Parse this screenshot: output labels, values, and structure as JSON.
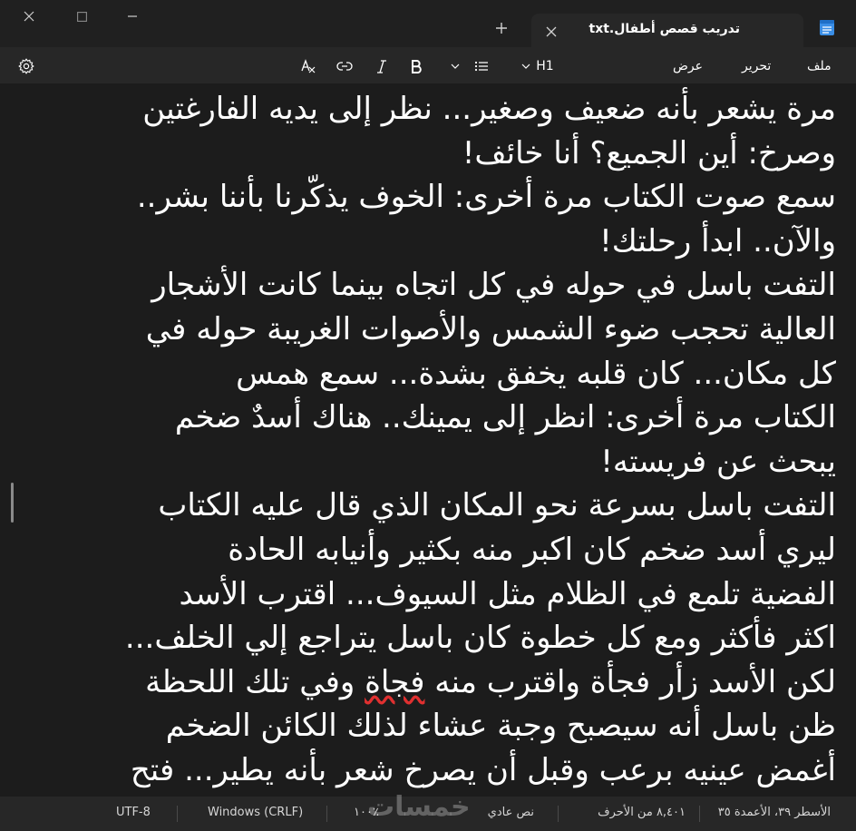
{
  "window": {
    "tab_title": "تدريب قصص أطفال.txt"
  },
  "menu": {
    "file": "ملف",
    "edit": "تحرير",
    "view": "عرض"
  },
  "toolbar": {
    "heading": "H1"
  },
  "editor": {
    "lines": [
      "مرة يشعر بأنه ضعيف وصغير... نظر إلى يديه الفارغتين",
      "وصرخ: أين الجميع؟ أنا خائف!",
      "سمع صوت الكتاب مرة أخرى: الخوف يذكّرنا بأننا بشر..",
      "والآن.. ابدأ رحلتك!",
      "التفت باسل في حوله في كل اتجاه بينما كانت الأشجار",
      " العالية تحجب ضوء الشمس والأصوات الغريبة حوله في",
      "كل مكان... كان قلبه يخفق بشدة... سمع همس",
      "الكتاب مرة أخرى: انظر إلى يمينك.. هناك أسدٌ ضخم",
      "يبحث عن فريسته!",
      "التفت باسل بسرعة نحو المكان الذي قال عليه الكتاب",
      "ليري أسد ضخم كان اكبر منه بكثير وأنيابه الحادة",
      "الفضية تلمع في الظلام مثل السيوف... اقترب الأسد",
      "اكثر فأكثر ومع كل خطوة كان باسل يتراجع إلي الخلف...",
      " لكن الأسد زأر فجأة واقترب منه فجاة وفي تلك اللحظة",
      "ظن باسل أنه سيصبح وجبة عشاء لذلك الكائن الضخم",
      "أغمض عينيه برعب وقبل أن يصرخ شعر بأنه يطير... فتح"
    ],
    "line14_pre": " لكن الأسد زأر فجأة واقترب منه ",
    "line14_err": "فجاة",
    "line14_post": " وفي تلك اللحظة"
  },
  "status": {
    "position": "الأسطر ٣٩، الأعمدة ٣٥",
    "chars": "٨,٤٠١ من الأحرف",
    "format": "نص عادي",
    "zoom": "١٠٠٪",
    "line_ending": "Windows (CRLF)",
    "encoding": "UTF-8"
  },
  "watermark": "خمسات"
}
